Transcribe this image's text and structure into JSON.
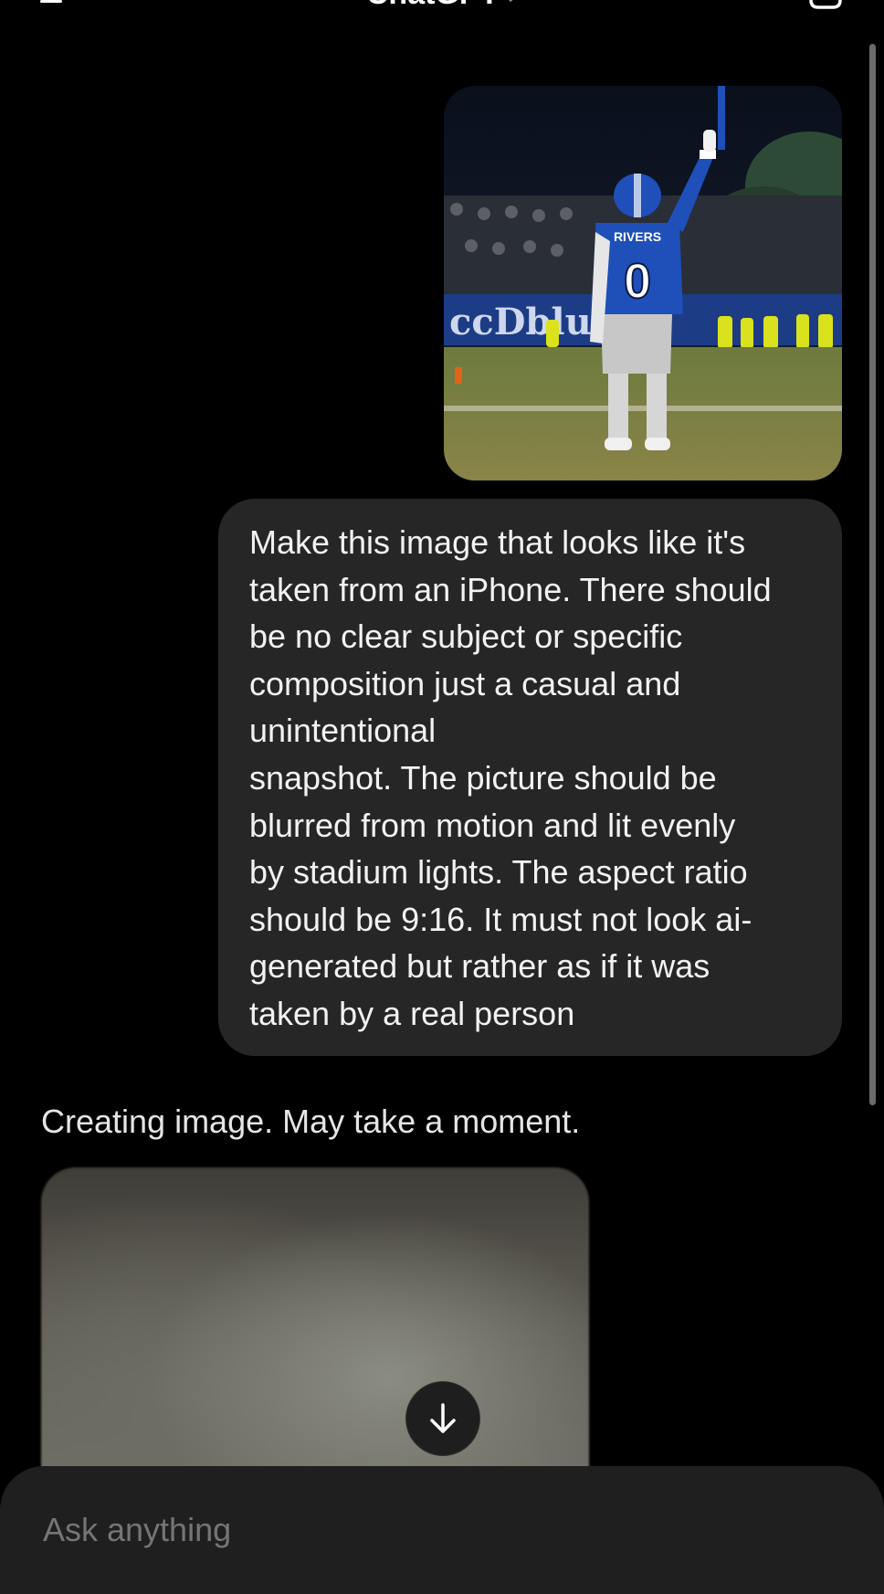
{
  "header": {
    "title": "ChatGPT",
    "title_chevron": "›"
  },
  "user_message": {
    "photo_jersey_name": "RIVERS",
    "photo_jersey_number": "0",
    "text": "Make this image that looks like it's\ntaken from an iPhone. There should\nbe no clear subject or specific\ncomposition just a casual and\nunintentional\nsnapshot. The picture should be\nblurred from motion and lit evenly\nby stadium lights. The aspect ratio\nshould be 9:16. It must not look ai-\ngenerated but rather as if it was\ntaken by a real person"
  },
  "assistant": {
    "status": "Creating image. May take a moment."
  },
  "composer": {
    "placeholder": "Ask anything"
  },
  "icons": {
    "menu": "menu-icon",
    "new_chat": "new-chat-icon",
    "scroll_down": "arrow-down-icon"
  },
  "colors": {
    "background": "#000000",
    "bubble": "#262626",
    "composer": "#1f1f1f",
    "jersey_blue": "#1f4fb8"
  }
}
